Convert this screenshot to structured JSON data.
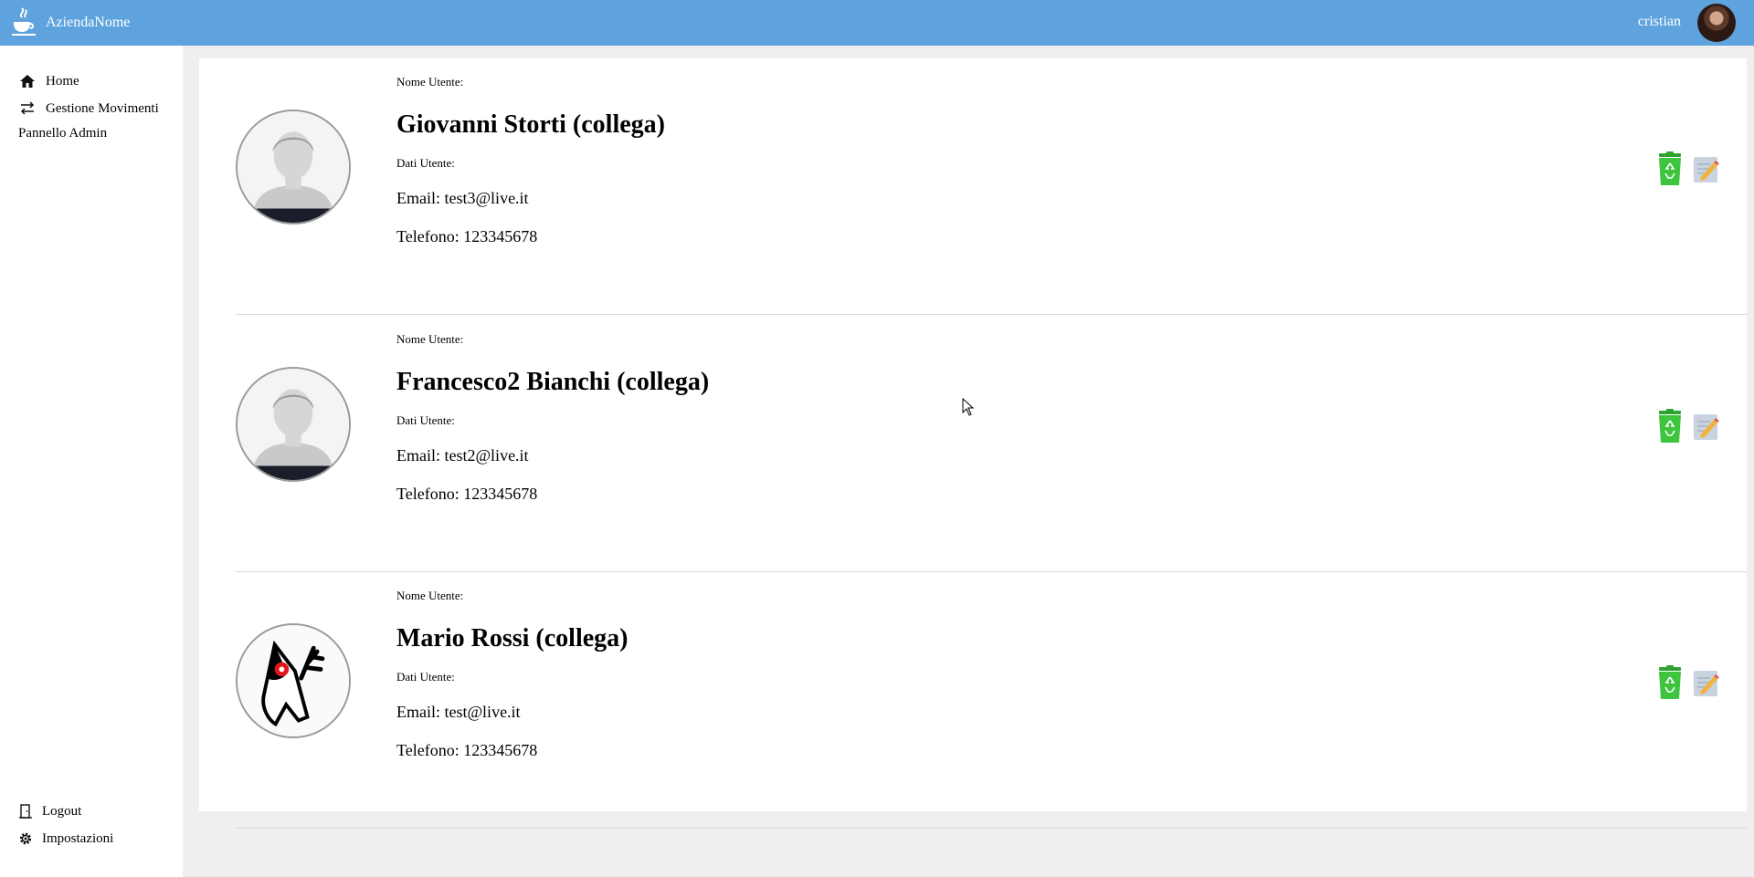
{
  "header": {
    "brand": "AziendaNome",
    "user": "cristian",
    "brand_icon": "java-cup-icon"
  },
  "sidebar": {
    "items": [
      {
        "label": "Home",
        "icon": "home-icon"
      },
      {
        "label": "Gestione Movimenti",
        "icon": "arrows-swap-icon"
      },
      {
        "label": "Pannello Admin"
      }
    ],
    "bottom": [
      {
        "label": "Logout",
        "icon": "door-icon"
      },
      {
        "label": "Impostazioni",
        "icon": "gear-icon"
      }
    ]
  },
  "users": [
    {
      "username_label": "Nome Utente:",
      "name": "Giovanni Storti (collega)",
      "data_label": "Dati Utente:",
      "email": "Email: test3@live.it",
      "phone": "Telefono: 123345678",
      "avatar": "default-user-icon"
    },
    {
      "username_label": "Nome Utente:",
      "name": "Francesco2 Bianchi (collega)",
      "data_label": "Dati Utente:",
      "email": "Email: test2@live.it",
      "phone": "Telefono: 123345678",
      "avatar": "default-user-icon"
    },
    {
      "username_label": "Nome Utente:",
      "name": "Mario Rossi (collega)",
      "data_label": "Dati Utente:",
      "email": "Email: test@live.it",
      "phone": "Telefono: 123345678",
      "avatar": "java-duke-icon"
    }
  ],
  "colors": {
    "topbar": "#5ea3de",
    "delete": "#3ec43e",
    "background": "#efefef"
  }
}
